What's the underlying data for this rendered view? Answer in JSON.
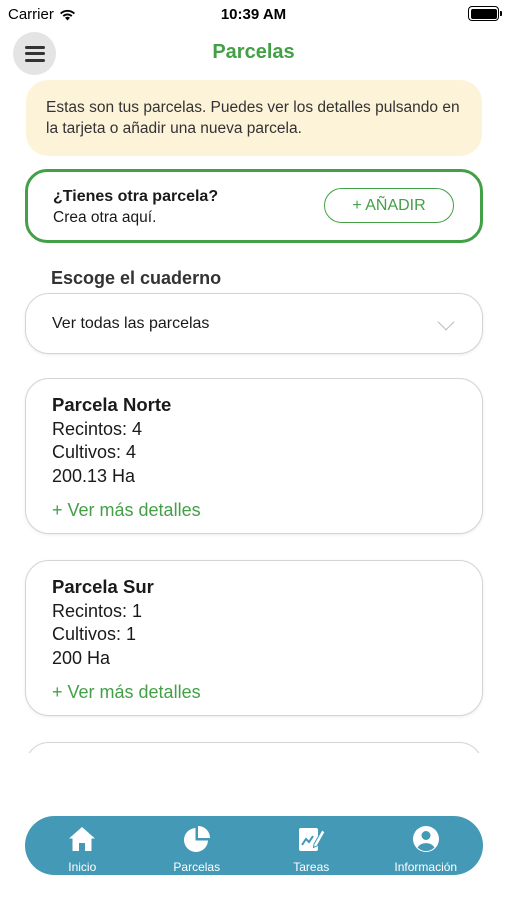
{
  "status_bar": {
    "carrier": "Carrier",
    "time": "10:39 AM"
  },
  "header": {
    "title": "Parcelas"
  },
  "info_banner": {
    "text": "Estas son tus parcelas. Puedes ver los detalles pulsando en la tarjeta o añadir una nueva parcela."
  },
  "add_card": {
    "question": "¿Tienes otra parcela?",
    "subtitle": "Crea otra aquí.",
    "button_label": "+ AÑADIR"
  },
  "notebook": {
    "label": "Escoge el cuaderno",
    "selected": "Ver todas las parcelas"
  },
  "parcels": [
    {
      "name": "Parcela Norte",
      "recintos": "Recintos: 4",
      "cultivos": "Cultivos: 4",
      "area": "200.13 Ha",
      "more": "+ Ver más detalles"
    },
    {
      "name": "Parcela Sur",
      "recintos": "Recintos: 1",
      "cultivos": "Cultivos: 1",
      "area": "200 Ha",
      "more": "+ Ver más detalles"
    }
  ],
  "tabs": [
    {
      "label": "Inicio",
      "icon": "home-icon"
    },
    {
      "label": "Parcelas",
      "icon": "pie-chart-icon"
    },
    {
      "label": "Tareas",
      "icon": "task-edit-icon"
    },
    {
      "label": "Información",
      "icon": "user-circle-icon"
    }
  ],
  "colors": {
    "accent": "#43a047",
    "banner": "#fdf3d9",
    "tab_bar": "#4499b7"
  }
}
